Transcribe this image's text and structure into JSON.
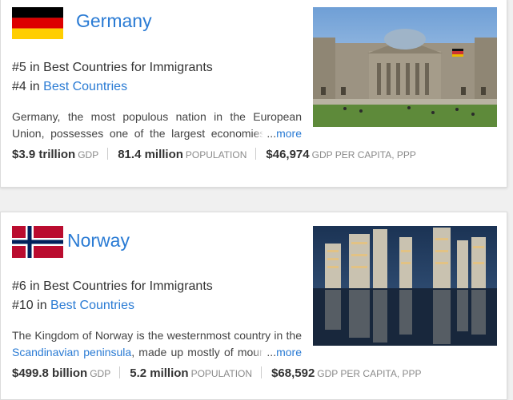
{
  "cards": [
    {
      "country": "Germany",
      "rank1": {
        "prefix": "#5 in ",
        "category": "Best Countries for Immigrants"
      },
      "rank2": {
        "prefix": "#4 in ",
        "link": "Best Countries"
      },
      "description": "Germany, the most populous nation in the European Union, possesses one of the largest economies in the world.",
      "more": "more",
      "ellipsis": "...",
      "stats": [
        {
          "value": "$3.9 trillion",
          "label": "GDP"
        },
        {
          "value": "81.4 million",
          "label": "POPULATION"
        },
        {
          "value": "$46,974",
          "label": "GDP PER CAPITA, PPP"
        }
      ]
    },
    {
      "country": "Norway",
      "rank1": {
        "prefix": "#6 in ",
        "category": "Best Countries for Immigrants"
      },
      "rank2": {
        "prefix": "#10 in ",
        "link": "Best Countries"
      },
      "description_pre": "The Kingdom of Norway is the westernmost country in the ",
      "description_link": "Scandinavian peninsula",
      "description_post": ", made up mostly of mountainous terrain.",
      "more": "more",
      "ellipsis": "...",
      "stats": [
        {
          "value": "$499.8 billion",
          "label": "GDP"
        },
        {
          "value": "5.2 million",
          "label": "POPULATION"
        },
        {
          "value": "$68,592",
          "label": "GDP PER CAPITA, PPP"
        }
      ]
    }
  ],
  "colors": {
    "link": "#2a7bd4",
    "text": "#333333",
    "muted": "#8a8a8a"
  },
  "icons": {
    "germany_flag": "germany-flag-icon",
    "norway_flag": "norway-flag-icon"
  }
}
